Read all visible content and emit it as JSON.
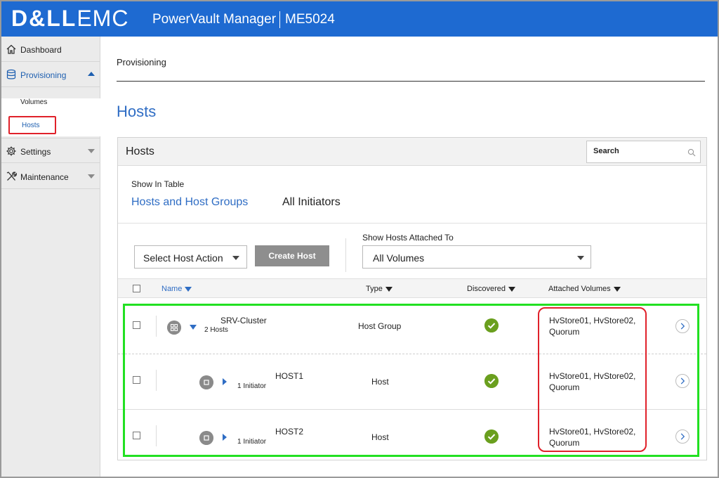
{
  "header": {
    "brand_bold": "D&LL",
    "brand_light": "EMC",
    "app_title": "PowerVault Manager",
    "model": "ME5024",
    "bg_color": "#1e6ad1"
  },
  "sidebar": {
    "items": [
      {
        "label": "Dashboard",
        "icon": "home-icon"
      },
      {
        "label": "Provisioning",
        "icon": "database-icon",
        "expanded": true
      },
      {
        "label": "Settings",
        "icon": "gear-icon"
      },
      {
        "label": "Maintenance",
        "icon": "tools-icon"
      }
    ],
    "sub_items": [
      {
        "label": "Volumes"
      },
      {
        "label": "Hosts",
        "selected": true
      }
    ]
  },
  "breadcrumb": "Provisioning",
  "page_title": "Hosts",
  "panel": {
    "title": "Hosts",
    "search_placeholder": "Search",
    "show_in_table_label": "Show In Table",
    "tabs": [
      {
        "label": "Hosts and Host Groups",
        "active": true
      },
      {
        "label": "All Initiators",
        "active": false
      }
    ],
    "host_action_select": "Select Host Action",
    "create_host_button": "Create Host",
    "show_attached_label": "Show Hosts Attached To",
    "attached_select": "All Volumes"
  },
  "table": {
    "columns": {
      "name": "Name",
      "type": "Type",
      "discovered": "Discovered",
      "attached": "Attached Volumes"
    },
    "rows": [
      {
        "name": "SRV-Cluster",
        "subtext": "2 Hosts",
        "type": "Host Group",
        "discovered": true,
        "attached_line1": "HvStore01, HvStore02,",
        "attached_line2": "Quorum"
      },
      {
        "name": "HOST1",
        "subtext": "1 Initiator",
        "type": "Host",
        "discovered": true,
        "attached_line1": "HvStore01, HvStore02,",
        "attached_line2": "Quorum"
      },
      {
        "name": "HOST2",
        "subtext": "1 Initiator",
        "type": "Host",
        "discovered": true,
        "attached_line1": "HvStore01, HvStore02,",
        "attached_line2": "Quorum"
      }
    ]
  },
  "highlights": {
    "green": "#22e022",
    "red": "#e0212a"
  }
}
